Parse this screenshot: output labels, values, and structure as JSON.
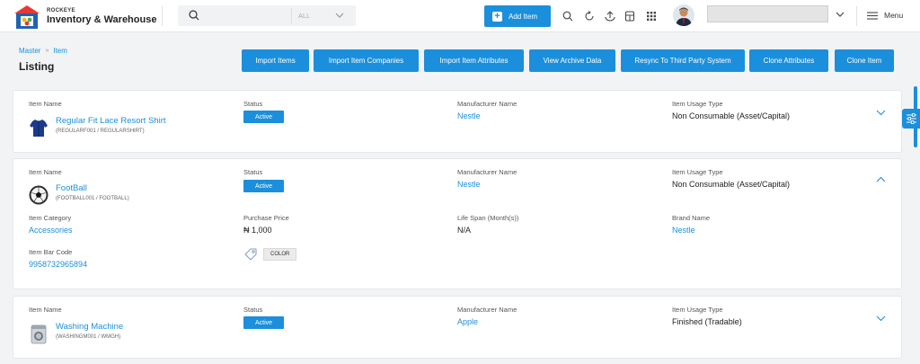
{
  "brand": {
    "small": "ROCKEYE",
    "name": "Inventory & Warehouse"
  },
  "search": {
    "placeholder": "",
    "filter": "ALL"
  },
  "toolbar": {
    "add_item": "Add Item",
    "menu": "Menu"
  },
  "breadcrumb": {
    "root": "Master",
    "current": "Item"
  },
  "page_title": "Listing",
  "actions": [
    "Import Items",
    "Import Item Companies",
    "Import Item Attributes",
    "View Archive Data",
    "Resync To Third Party System",
    "Clone Attributes",
    "Clone Item"
  ],
  "labels": {
    "item_name": "Item Name",
    "status": "Status",
    "manufacturer": "Manufacturer Name",
    "usage": "Item Usage Type",
    "category": "Item Category",
    "price": "Purchase Price",
    "life": "Life Span (Month(s))",
    "brand": "Brand Name",
    "barcode": "Item Bar Code"
  },
  "items": [
    {
      "name": "Regular Fit Lace Resort Shirt",
      "code": "(REGULARF001 / REGULARSHIRT)",
      "status": "Active",
      "manufacturer": "Nestle",
      "usage": "Non Consumable (Asset/Capital)"
    },
    {
      "name": "FootBall",
      "code": "(FOOTBALL001 / FOOTBALL)",
      "status": "Active",
      "manufacturer": "Nestle",
      "usage": "Non Consumable (Asset/Capital)",
      "category": "Accessories",
      "price": "₦ 1,000",
      "life": "N/A",
      "brand": "Nestle",
      "barcode": "9958732965894",
      "attribute": "COLOR"
    },
    {
      "name": "Washing Machine",
      "code": "(WASHINGM001 / WMGH)",
      "status": "Active",
      "manufacturer": "Apple",
      "usage": "Finished (Tradable)"
    }
  ],
  "colors": {
    "accent": "#1b8fdc",
    "background": "#f2f3f5"
  }
}
